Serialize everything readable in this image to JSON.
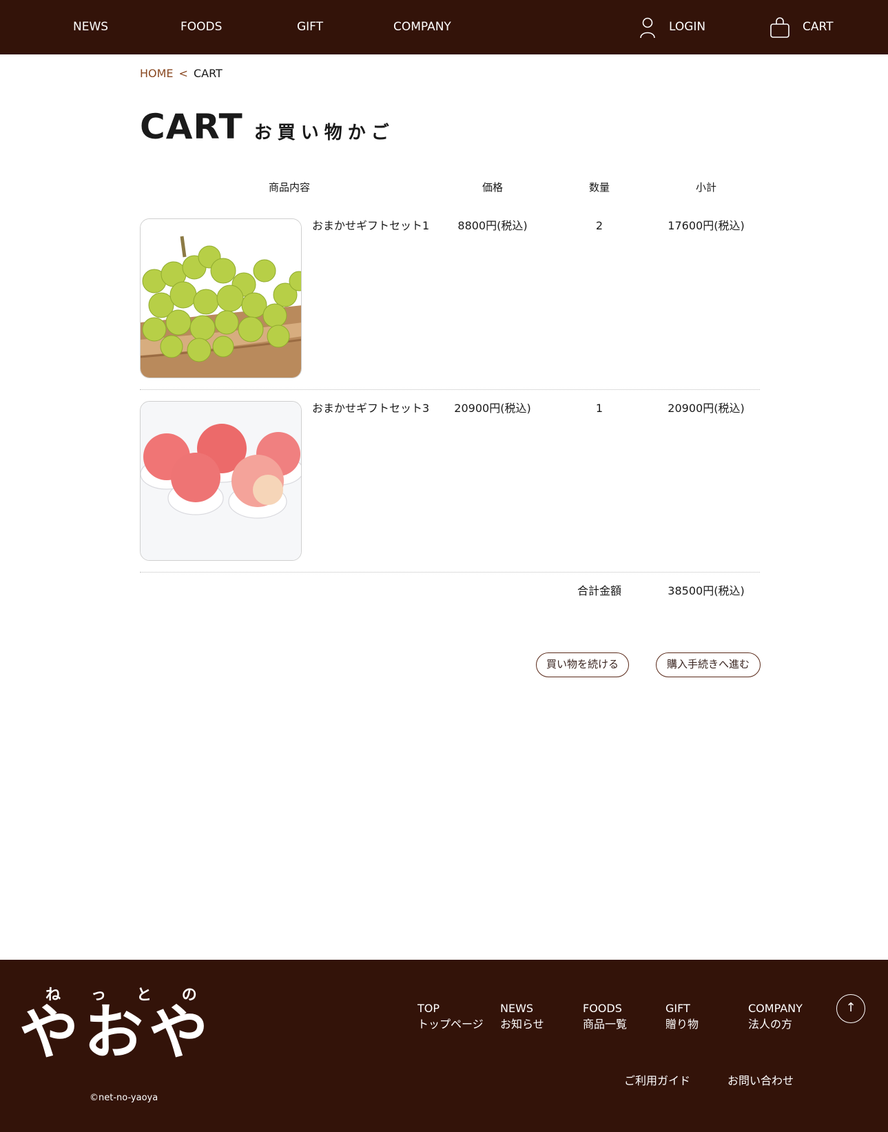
{
  "header": {
    "nav": [
      "NEWS",
      "FOODS",
      "GIFT",
      "COMPANY"
    ],
    "login": "LOGIN",
    "cart": "CART",
    "bg_color": "#331309"
  },
  "breadcrumb": {
    "home": "HOME",
    "separator": "<",
    "current": "CART"
  },
  "page": {
    "title_en": "CART",
    "title_jp": "お買い物かご"
  },
  "table": {
    "headers": {
      "product": "商品内容",
      "price": "価格",
      "qty": "数量",
      "subtotal": "小計"
    },
    "rows": [
      {
        "name": "おまかせギフトセット1",
        "price": "8800円(税込)",
        "qty": "2",
        "subtotal": "17600円(税込)",
        "image": "grapes-photo"
      },
      {
        "name": "おまかせギフトセット3",
        "price": "20900円(税込)",
        "qty": "1",
        "subtotal": "20900円(税込)",
        "image": "peaches-photo"
      }
    ],
    "total_label": "合計金額",
    "total_value": "38500円(税込)"
  },
  "buttons": {
    "continue": "買い物を続ける",
    "checkout": "購入手続きへ進む"
  },
  "footer": {
    "logo_small": "ねっとの",
    "logo_large": "やおや",
    "links": [
      {
        "en": "TOP",
        "jp": "トップページ"
      },
      {
        "en": "NEWS",
        "jp": "お知らせ"
      },
      {
        "en": "FOODS",
        "jp": "商品一覧"
      },
      {
        "en": "GIFT",
        "jp": "贈り物"
      },
      {
        "en": "COMPANY",
        "jp": "法人の方"
      }
    ],
    "guide": "ご利用ガイド",
    "contact": "お問い合わせ",
    "copyright": "©net-no-yaoya",
    "to_top_icon": "arrow-up-icon"
  }
}
